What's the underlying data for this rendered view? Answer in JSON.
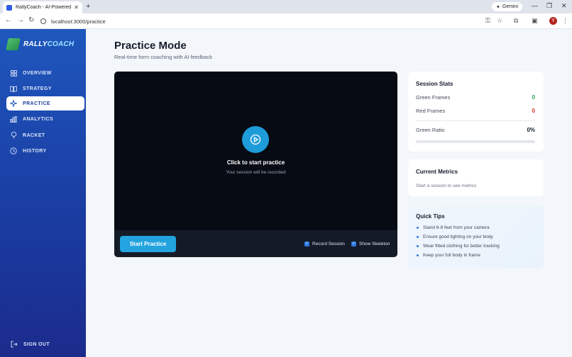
{
  "browser": {
    "tab_title": "RallyCoach - AI-Powered Ba",
    "new_tab": "+",
    "gemini_label": "Gemini",
    "url": "localhost:3000/practice",
    "profile_initial": "Y"
  },
  "brand": {
    "name_part1": "RALLY",
    "name_part2": "COACH"
  },
  "sidebar": {
    "items": [
      {
        "label": "OVERVIEW",
        "icon": "grid-icon",
        "active": false
      },
      {
        "label": "STRATEGY",
        "icon": "book-icon",
        "active": false
      },
      {
        "label": "PRACTICE",
        "icon": "sparkle-icon",
        "active": true
      },
      {
        "label": "ANALYTICS",
        "icon": "bar-chart-icon",
        "active": false
      },
      {
        "label": "RACKET",
        "icon": "racket-icon",
        "active": false
      },
      {
        "label": "HISTORY",
        "icon": "clock-icon",
        "active": false
      }
    ],
    "signout_label": "SIGN OUT"
  },
  "page": {
    "title": "Practice Mode",
    "subtitle": "Real-time form coaching with AI feedback"
  },
  "video": {
    "prompt_title": "Click to start practice",
    "prompt_sub": "Your session will be recorded",
    "start_button": "Start Practice",
    "record_label": "Record Session",
    "skeleton_label": "Show Skeleton",
    "record_checked": true,
    "skeleton_checked": true
  },
  "session_stats": {
    "title": "Session Stats",
    "green_label": "Green Frames",
    "green_value": "0",
    "red_label": "Red Frames",
    "red_value": "0",
    "ratio_label": "Green Ratio",
    "ratio_value": "0%",
    "ratio_fraction": 0
  },
  "metrics": {
    "title": "Current Metrics",
    "empty_text": "Start a session to see metrics"
  },
  "tips": {
    "title": "Quick Tips",
    "items": [
      "Stand 6-8 feet from your camera",
      "Ensure good lighting on your body",
      "Wear fitted clothing for better tracking",
      "Keep your full body in frame"
    ]
  },
  "colors": {
    "accent": "#23a3e0",
    "green": "#2ba35a",
    "red": "#d93025",
    "sidebar_top": "#1f57bd",
    "sidebar_bottom": "#1b2b8c"
  }
}
